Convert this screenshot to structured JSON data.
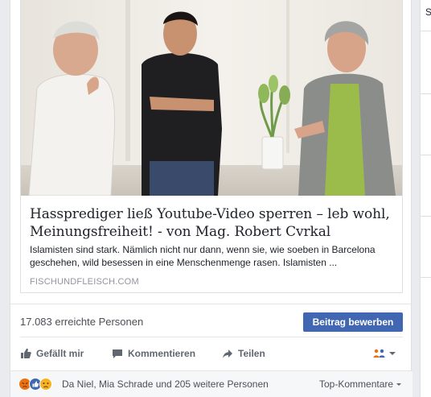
{
  "link_preview": {
    "title": "Hassprediger ließ Youtube-Video sperren – leb wohl, Meinungsfreiheit! - von Mag. Robert Cvrkal",
    "description": "Islamisten sind stark. Nämlich nicht nur dann, wenn sie, wie soeben in Barcelona geschehen, wild besessen in eine Menschenmenge rasen. Islamisten ...",
    "domain": "FISCHUNDFLEISCH.COM"
  },
  "stats": {
    "reach_text": "17.083 erreichte Personen",
    "boost_label": "Beitrag bewerben"
  },
  "actions": {
    "like_label": "Gefällt mir",
    "comment_label": "Kommentieren",
    "share_label": "Teilen"
  },
  "reactions": {
    "names_text": "Da Niel, Mia Schrade und 205 weitere Personen",
    "top_comments_label": "Top-Kommentare"
  },
  "right_column": {
    "glyph": "S"
  },
  "colors": {
    "brand_blue": "#4267b2",
    "like_blue": "#4267b2",
    "angry_orange": "#e9710f",
    "sad_yellow": "#f7b125"
  },
  "icons": [
    "thumbs-up-icon",
    "comment-bubble-icon",
    "share-arrow-icon",
    "audience-people-icon",
    "chevron-down-icon",
    "angry-reaction-icon",
    "like-reaction-icon",
    "sad-reaction-icon"
  ]
}
